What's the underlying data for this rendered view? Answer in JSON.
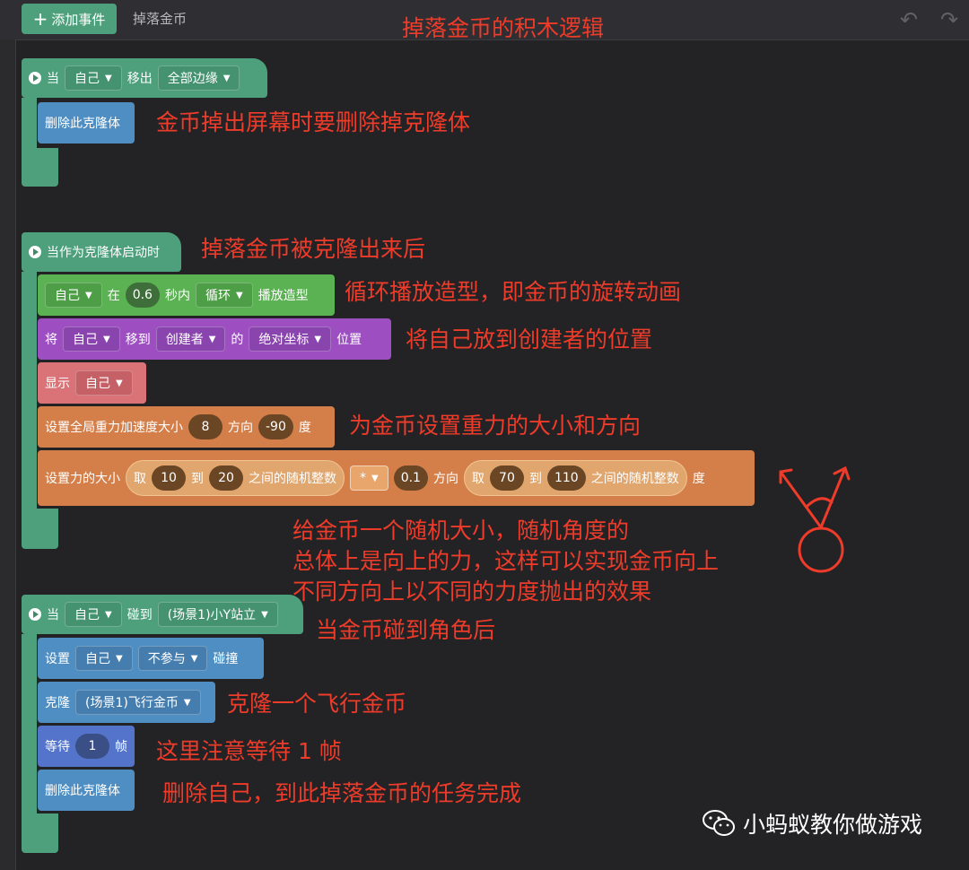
{
  "toolbar": {
    "add_event_label": "添加事件",
    "add_icon": "plus-icon",
    "tab_title": "掉落金币",
    "undo_icon": "undo-icon",
    "redo_icon": "redo-icon"
  },
  "annotations": {
    "title": "掉落金币的积木逻辑",
    "a1": "金币掉出屏幕时要删除掉克隆体",
    "a2": "掉落金币被克隆出来后",
    "a3": "循环播放造型，即金币的旋转动画",
    "a4": "将自己放到创建者的位置",
    "a5": "为金币设置重力的大小和方向",
    "a6": [
      "给金币一个随机大小，随机角度的",
      "总体上是向上的力，这样可以实现金币向上",
      "不同方向上以不同的力度抛出的效果"
    ],
    "a7": "当金币碰到角色后",
    "a8": "克隆一个飞行金币",
    "a9": "这里注意等待 1 帧",
    "a10": "删除自己，到此掉落金币的任务完成"
  },
  "event1": {
    "when": "当",
    "target": "自己",
    "action": "移出",
    "edge": "全部边缘",
    "delete_label": "删除此克隆体"
  },
  "event2": {
    "hat": "当作为克隆体启动时",
    "anim": {
      "target": "自己",
      "in": "在",
      "seconds": "0.6",
      "within": "秒内",
      "mode": "循环",
      "play": "播放造型"
    },
    "move": {
      "set": "将",
      "target": "自己",
      "moveto": "移到",
      "dest": "创建者",
      "of": "的",
      "coord": "绝对坐标",
      "pos": "位置"
    },
    "show": {
      "label": "显示",
      "target": "自己"
    },
    "gravity": {
      "label": "设置全局重力加速度大小",
      "value": "8",
      "dir_label": "方向",
      "dir": "-90",
      "unit": "度"
    },
    "force": {
      "label": "设置力的大小",
      "take": "取",
      "min": "10",
      "to": "到",
      "max": "20",
      "between": "之间的随机整数",
      "op": "*",
      "factor": "0.1",
      "dir_label": "方向",
      "take2": "取",
      "min2": "70",
      "to2": "到",
      "max2": "110",
      "between2": "之间的随机整数",
      "unit": "度"
    }
  },
  "event3": {
    "when": "当",
    "target": "自己",
    "action": "碰到",
    "other": "(场景1)小Y站立",
    "set": {
      "label": "设置",
      "target": "自己",
      "value": "不参与",
      "suffix": "碰撞"
    },
    "clone": {
      "label": "克隆",
      "target": "(场景1)飞行金币"
    },
    "wait": {
      "label": "等待",
      "value": "1",
      "unit": "帧"
    },
    "delete_label": "删除此克隆体"
  },
  "watermark": {
    "text": "小蚂蚁教你做游戏",
    "icon": "wechat-icon"
  },
  "colors": {
    "annotation": "#ee3b2a",
    "event": "#4ea07c",
    "looks": "#5ab252",
    "motion": "#9d4fc2",
    "physics": "#d47f49",
    "control": "#4f8ec2",
    "wait": "#5474cc"
  }
}
